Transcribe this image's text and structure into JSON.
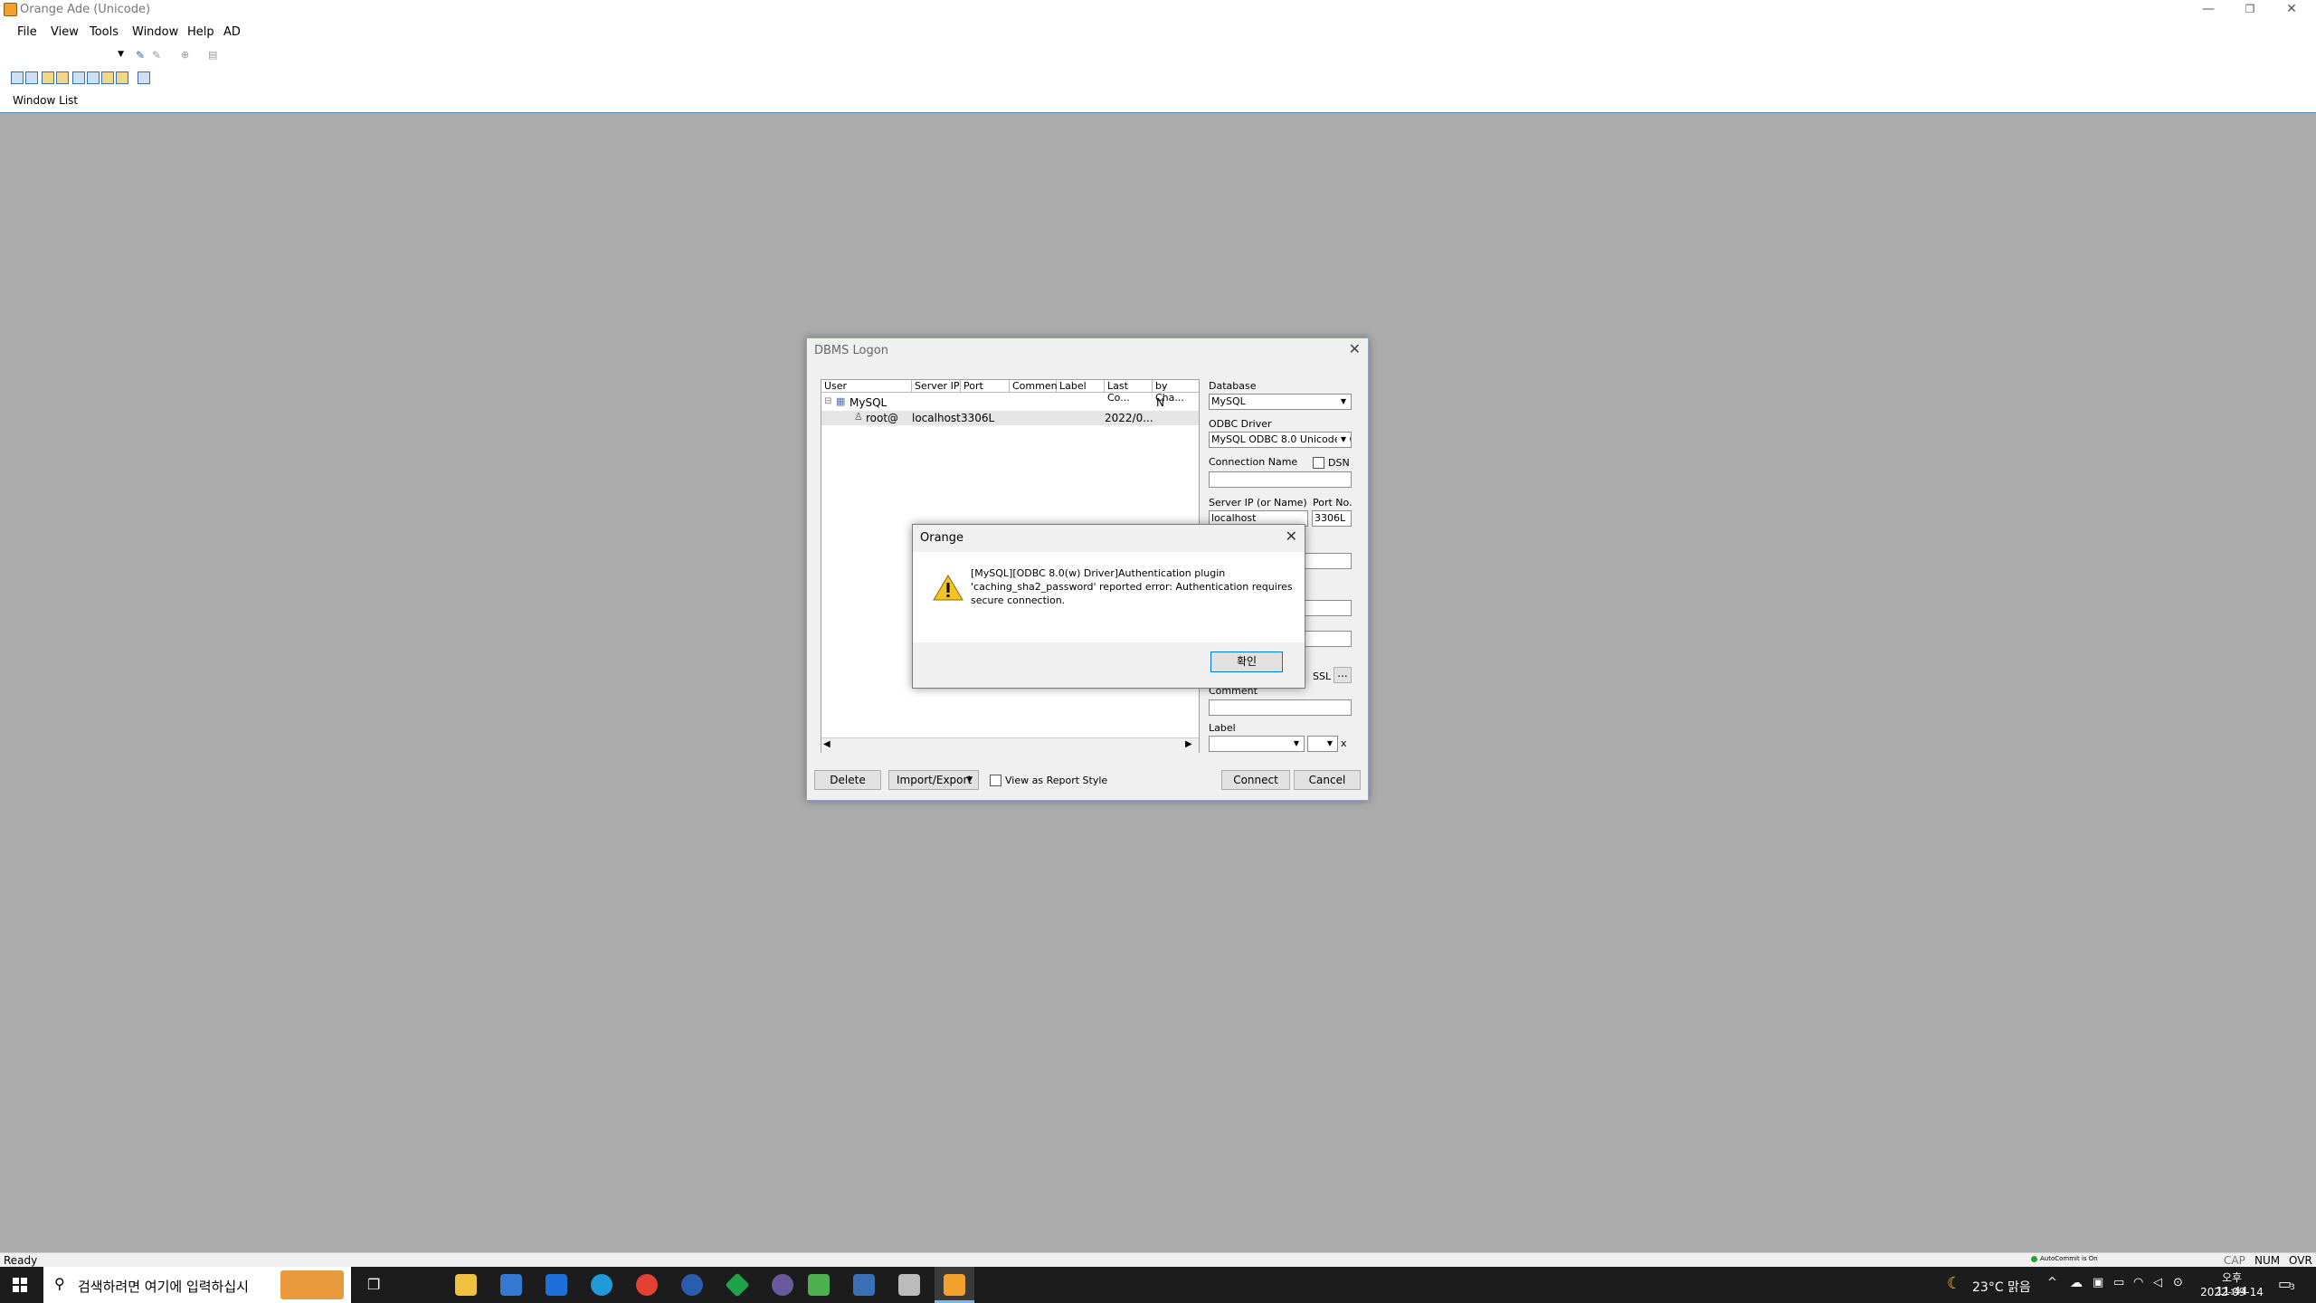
{
  "app": {
    "title": "Orange Ade (Unicode)"
  },
  "menu": [
    "File",
    "View",
    "Tools",
    "Window",
    "Help",
    "AD"
  ],
  "window_list": {
    "label": "Window List"
  },
  "status": {
    "text": "Ready",
    "autocommit": "AutoCommit is On",
    "indicators": [
      "CAP",
      "NUM",
      "OVR"
    ]
  },
  "dbms_dialog": {
    "title": "DBMS Logon",
    "columns": [
      "User",
      "Server IP",
      "Port",
      "Comment",
      "Label",
      "Last Co...",
      "by Cha..."
    ],
    "tree": {
      "group": {
        "name": "MySQL",
        "by_change": "N"
      },
      "row": {
        "user": "root@",
        "server": "localhost",
        "port": "3306L",
        "last": "2022/0..."
      }
    },
    "database_label": "Database",
    "database_value": "MySQL",
    "odbc_label": "ODBC Driver",
    "odbc_value": "MySQL ODBC 8.0 Unicode Dr",
    "connection_name_label": "Connection Name",
    "dsn_label": "DSN",
    "server_label": "Server IP (or Name)",
    "port_label": "Port No.",
    "server_value": "localhost",
    "port_value": "3306L",
    "ssl_label": "SSL",
    "ssl_btn": "...",
    "comment_label": "Comment",
    "label_label": "Label",
    "label_clear": "x",
    "buttons": {
      "delete": "Delete",
      "import_export": "Import/Export",
      "report_style": "View as Report Style",
      "connect": "Connect",
      "cancel": "Cancel"
    }
  },
  "alert": {
    "title": "Orange",
    "message_line1": "[MySQL][ODBC 8.0(w) Driver]Authentication plugin",
    "message_line2": "'caching_sha2_password' reported error: Authentication requires",
    "message_line3": "secure connection.",
    "ok": "확인"
  },
  "taskbar": {
    "search_placeholder": "검색하려면 여기에 입력하십시",
    "weather": "23°C 맑음",
    "time": "오후 11:44",
    "date": "2022-09-14",
    "notifications": "3"
  }
}
